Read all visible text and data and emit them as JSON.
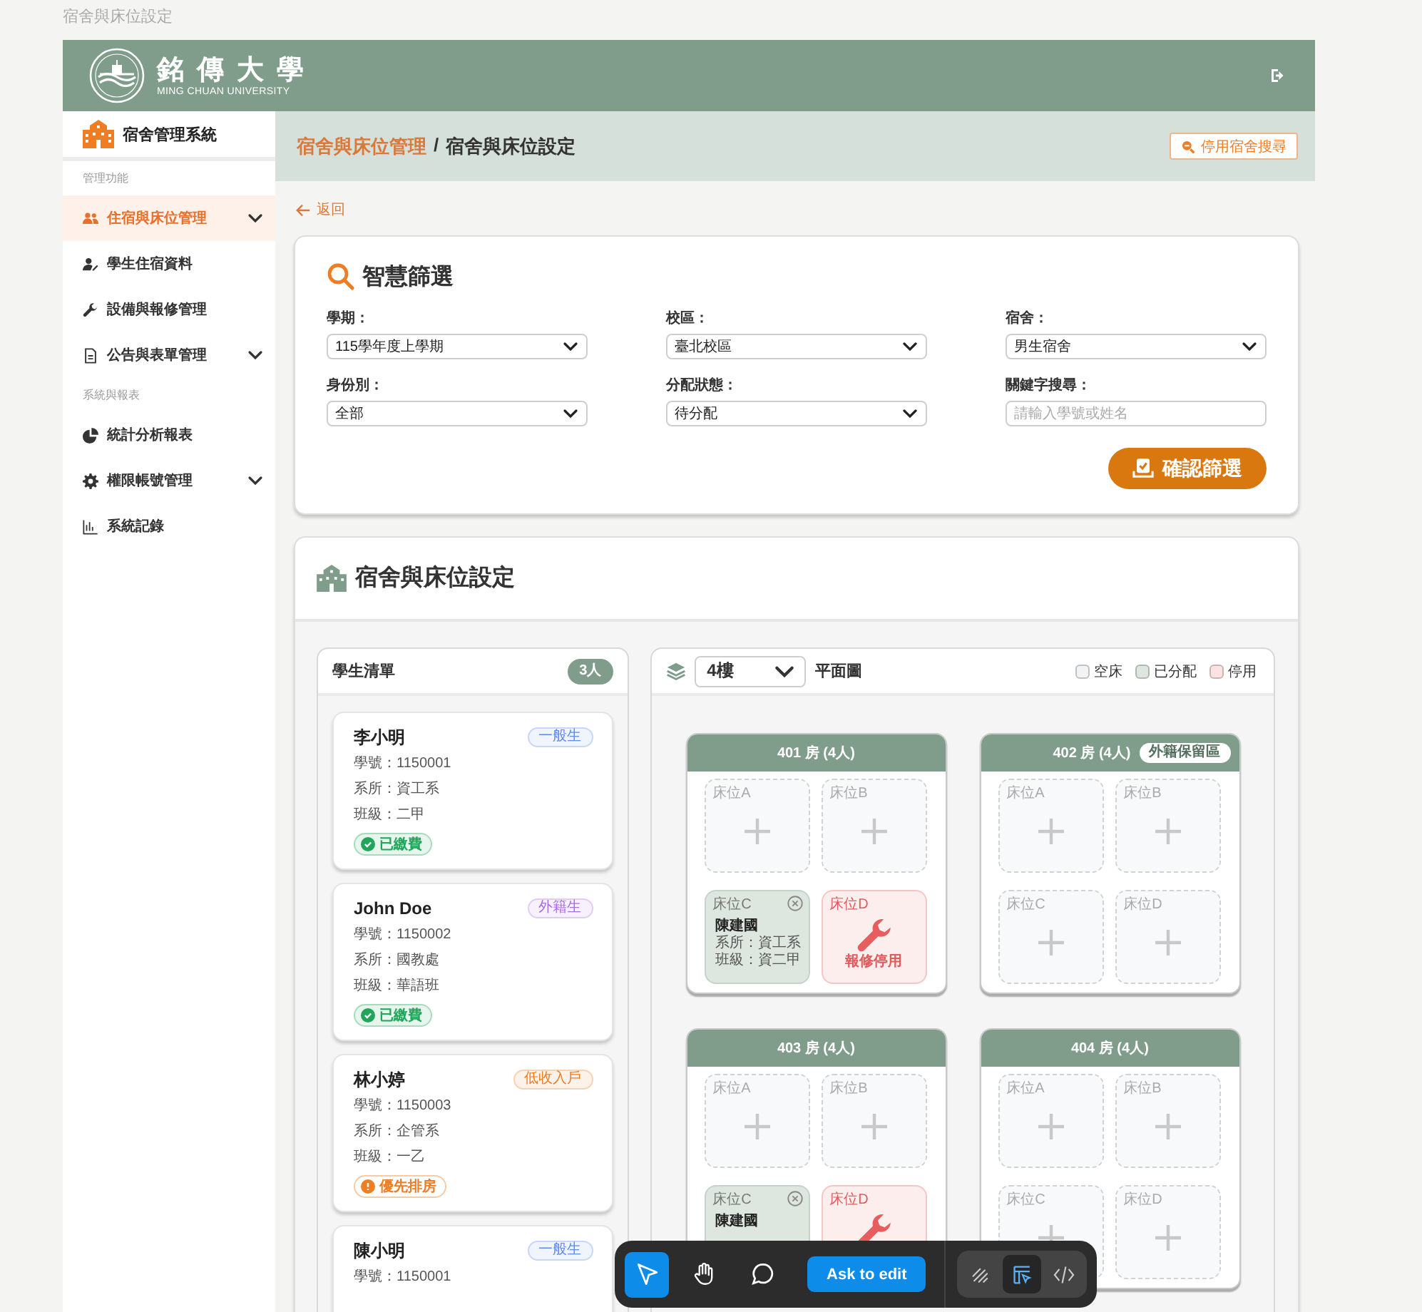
{
  "page_title": "宿舍與床位設定",
  "header": {
    "logo_name": "銘傳大學",
    "logo_subtitle": "MING CHUAN UNIVERSITY"
  },
  "sidebar": {
    "title": "宿舍管理系統",
    "groups": [
      {
        "label": "管理功能",
        "items": [
          {
            "label": "住宿與床位管理",
            "kind": "users",
            "has_submenu": true,
            "selected": true
          },
          {
            "label": "學生住宿資料",
            "kind": "user-edit",
            "has_submenu": false,
            "selected": false
          },
          {
            "label": "設備與報修管理",
            "kind": "wrench",
            "has_submenu": false,
            "selected": false
          },
          {
            "label": "公告與表單管理",
            "kind": "document",
            "has_submenu": true,
            "selected": false
          }
        ]
      },
      {
        "label": "系統與報表",
        "items": [
          {
            "label": "統計分析報表",
            "kind": "pie",
            "has_submenu": false,
            "selected": false
          },
          {
            "label": "權限帳號管理",
            "kind": "gear",
            "has_submenu": true,
            "selected": false
          },
          {
            "label": "系統記錄",
            "kind": "chart",
            "has_submenu": false,
            "selected": false
          }
        ]
      }
    ]
  },
  "breadcrumb": {
    "parent": "宿舍與床位管理",
    "separator": "/",
    "current": "宿舍與床位設定",
    "action": "停用宿舍搜尋"
  },
  "back_link": "返回",
  "filter": {
    "title": "智慧篩選",
    "fields": [
      {
        "kind": "select",
        "label": "學期：",
        "value": "115學年度上學期"
      },
      {
        "kind": "select",
        "label": "校區：",
        "value": "臺北校區"
      },
      {
        "kind": "select",
        "label": "宿舍：",
        "value": "男生宿舍"
      },
      {
        "kind": "select",
        "label": "身份別：",
        "value": "全部"
      },
      {
        "kind": "select",
        "label": "分配狀態：",
        "value": "待分配"
      },
      {
        "kind": "text",
        "label": "關鍵字搜尋：",
        "placeholder": "請輸入學號或姓名"
      }
    ],
    "submit": "確認篩選"
  },
  "settings": {
    "title": "宿舍與床位設定",
    "students": {
      "title": "學生清單",
      "count": "3人",
      "items": [
        {
          "name": "李小明",
          "tag": {
            "text": "一般生",
            "color": "#5b8def"
          },
          "lines": [
            "學號：1150001",
            "系所：資工系",
            "班級：二甲"
          ],
          "status": {
            "kind": "paid",
            "text": "已繳費"
          }
        },
        {
          "name": "John Doe",
          "tag": {
            "text": "外籍生",
            "color": "#a66ee0"
          },
          "lines": [
            "學號：1150002",
            "系所：國教處",
            "班級：華語班"
          ],
          "status": {
            "kind": "paid",
            "text": "已繳費"
          }
        },
        {
          "name": "林小婷",
          "tag": {
            "text": "低收入戶",
            "color": "#ee7d24"
          },
          "lines": [
            "學號：1150003",
            "系所：企管系",
            "班級：一乙"
          ],
          "status": {
            "kind": "priority",
            "text": "優先排房"
          }
        },
        {
          "name": "陳小明",
          "tag": {
            "text": "一般生",
            "color": "#5b8def"
          },
          "lines": [
            "學號：1150001"
          ]
        }
      ]
    },
    "plan": {
      "floor": "4樓",
      "title": "平面圖",
      "legend": [
        {
          "text": "空床",
          "color": "#f1f3f5"
        },
        {
          "text": "已分配",
          "color": "#dde6df"
        },
        {
          "text": "停用",
          "color": "#fde2e2"
        }
      ],
      "rooms": [
        {
          "title": "401 房 (4人)",
          "beds": [
            {
              "label": "床位A",
              "kind": "empty"
            },
            {
              "label": "床位B",
              "kind": "empty"
            },
            {
              "label": "床位C",
              "kind": "assigned",
              "name": "陳建國",
              "details": [
                "系所：資工系",
                "班級：資二甲"
              ]
            },
            {
              "label": "床位D",
              "kind": "disabled",
              "note": "報修停用"
            }
          ]
        },
        {
          "title": "402 房 (4人)",
          "tag": "外籍保留區",
          "beds": [
            {
              "label": "床位A",
              "kind": "empty"
            },
            {
              "label": "床位B",
              "kind": "empty"
            },
            {
              "label": "床位C",
              "kind": "empty"
            },
            {
              "label": "床位D",
              "kind": "empty"
            }
          ]
        },
        {
          "title": "403 房 (4人)",
          "beds": [
            {
              "label": "床位A",
              "kind": "empty"
            },
            {
              "label": "床位B",
              "kind": "empty"
            },
            {
              "label": "床位C",
              "kind": "assigned",
              "name": "陳建國"
            },
            {
              "label": "床位D",
              "kind": "disabled"
            }
          ]
        },
        {
          "title": "404 房 (4人)",
          "beds": [
            {
              "label": "床位A",
              "kind": "empty"
            },
            {
              "label": "床位B",
              "kind": "empty"
            },
            {
              "label": "床位C",
              "kind": "empty"
            },
            {
              "label": "床位D",
              "kind": "empty"
            }
          ]
        }
      ]
    }
  },
  "dock": {
    "tools": [
      {
        "kind": "pointer",
        "selected": true
      },
      {
        "kind": "hand",
        "selected": false
      },
      {
        "kind": "comment",
        "selected": false
      }
    ],
    "action": "Ask to edit",
    "modes": [
      {
        "kind": "draw",
        "selected": false
      },
      {
        "kind": "design",
        "selected": true
      },
      {
        "kind": "code",
        "selected": false
      }
    ]
  }
}
